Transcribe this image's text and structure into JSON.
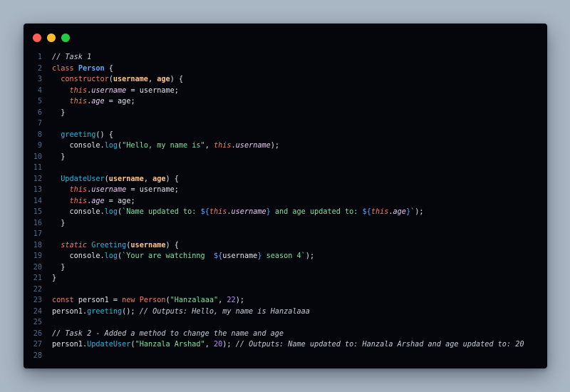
{
  "colors": {
    "background": "#a9b6c3",
    "editor_bg": "#04060b",
    "line_number": "#4e6a8c",
    "default": "#dfe3ea",
    "comment": "#c6ccd6",
    "keyword": "#f07d63",
    "class_name": "#5ba6ff",
    "method": "#27b6d6",
    "param": "#ffc58a",
    "this": "#f07d63",
    "property": "#e9c6ee",
    "string": "#7ee0a0",
    "number": "#bb8ef9",
    "interp": "#5ba6ff",
    "punct": "#dfe3ea",
    "dot_red": "#ff5f57",
    "dot_yellow": "#febc2e",
    "dot_green": "#28c840"
  },
  "window": {
    "controls": [
      "close-dot",
      "minimize-dot",
      "maximize-dot"
    ]
  },
  "lines": [
    {
      "n": "1",
      "tokens": [
        {
          "t": "// Task 1",
          "c": "comment"
        }
      ]
    },
    {
      "n": "2",
      "tokens": [
        {
          "t": "class ",
          "c": "keyword"
        },
        {
          "t": "Person",
          "c": "class_name",
          "b": true
        },
        {
          "t": " {",
          "c": "punct"
        }
      ]
    },
    {
      "n": "3",
      "tokens": [
        {
          "t": "  constructor",
          "c": "keyword"
        },
        {
          "t": "(",
          "c": "punct"
        },
        {
          "t": "username",
          "c": "param",
          "b": true
        },
        {
          "t": ", ",
          "c": "punct"
        },
        {
          "t": "age",
          "c": "param",
          "b": true
        },
        {
          "t": ") {",
          "c": "punct"
        }
      ]
    },
    {
      "n": "4",
      "tokens": [
        {
          "t": "    ",
          "c": "punct"
        },
        {
          "t": "this",
          "c": "this",
          "i": true
        },
        {
          "t": ".",
          "c": "punct"
        },
        {
          "t": "username",
          "c": "property",
          "i": true
        },
        {
          "t": " = ",
          "c": "punct"
        },
        {
          "t": "username",
          "c": "default"
        },
        {
          "t": ";",
          "c": "punct"
        }
      ]
    },
    {
      "n": "5",
      "tokens": [
        {
          "t": "    ",
          "c": "punct"
        },
        {
          "t": "this",
          "c": "this",
          "i": true
        },
        {
          "t": ".",
          "c": "punct"
        },
        {
          "t": "age",
          "c": "property",
          "i": true
        },
        {
          "t": " = ",
          "c": "punct"
        },
        {
          "t": "age",
          "c": "default"
        },
        {
          "t": ";",
          "c": "punct"
        }
      ]
    },
    {
      "n": "6",
      "tokens": [
        {
          "t": "  }",
          "c": "punct"
        }
      ]
    },
    {
      "n": "7",
      "tokens": []
    },
    {
      "n": "8",
      "tokens": [
        {
          "t": "  greeting",
          "c": "method"
        },
        {
          "t": "() {",
          "c": "punct"
        }
      ]
    },
    {
      "n": "9",
      "tokens": [
        {
          "t": "    console",
          "c": "default"
        },
        {
          "t": ".",
          "c": "punct"
        },
        {
          "t": "log",
          "c": "method"
        },
        {
          "t": "(",
          "c": "punct"
        },
        {
          "t": "\"Hello, my name is\"",
          "c": "string"
        },
        {
          "t": ", ",
          "c": "punct"
        },
        {
          "t": "this",
          "c": "this",
          "i": true
        },
        {
          "t": ".",
          "c": "punct"
        },
        {
          "t": "username",
          "c": "property",
          "i": true
        },
        {
          "t": ");",
          "c": "punct"
        }
      ]
    },
    {
      "n": "10",
      "tokens": [
        {
          "t": "  }",
          "c": "punct"
        }
      ]
    },
    {
      "n": "11",
      "tokens": []
    },
    {
      "n": "12",
      "tokens": [
        {
          "t": "  UpdateUser",
          "c": "method"
        },
        {
          "t": "(",
          "c": "punct"
        },
        {
          "t": "username",
          "c": "param",
          "b": true
        },
        {
          "t": ", ",
          "c": "punct"
        },
        {
          "t": "age",
          "c": "param",
          "b": true
        },
        {
          "t": ") {",
          "c": "punct"
        }
      ]
    },
    {
      "n": "13",
      "tokens": [
        {
          "t": "    ",
          "c": "punct"
        },
        {
          "t": "this",
          "c": "this",
          "i": true
        },
        {
          "t": ".",
          "c": "punct"
        },
        {
          "t": "username",
          "c": "property",
          "i": true
        },
        {
          "t": " = ",
          "c": "punct"
        },
        {
          "t": "username",
          "c": "default"
        },
        {
          "t": ";",
          "c": "punct"
        }
      ]
    },
    {
      "n": "14",
      "tokens": [
        {
          "t": "    ",
          "c": "punct"
        },
        {
          "t": "this",
          "c": "this",
          "i": true
        },
        {
          "t": ".",
          "c": "punct"
        },
        {
          "t": "age",
          "c": "property",
          "i": true
        },
        {
          "t": " = ",
          "c": "punct"
        },
        {
          "t": "age",
          "c": "default"
        },
        {
          "t": ";",
          "c": "punct"
        }
      ]
    },
    {
      "n": "15",
      "tokens": [
        {
          "t": "    console",
          "c": "default"
        },
        {
          "t": ".",
          "c": "punct"
        },
        {
          "t": "log",
          "c": "method"
        },
        {
          "t": "(",
          "c": "punct"
        },
        {
          "t": "`Name updated to: ",
          "c": "string"
        },
        {
          "t": "${",
          "c": "interp"
        },
        {
          "t": "this",
          "c": "this",
          "i": true
        },
        {
          "t": ".",
          "c": "punct"
        },
        {
          "t": "username",
          "c": "property",
          "i": true
        },
        {
          "t": "}",
          "c": "interp"
        },
        {
          "t": " and age updated to: ",
          "c": "string"
        },
        {
          "t": "${",
          "c": "interp"
        },
        {
          "t": "this",
          "c": "this",
          "i": true
        },
        {
          "t": ".",
          "c": "punct"
        },
        {
          "t": "age",
          "c": "property",
          "i": true
        },
        {
          "t": "}",
          "c": "interp"
        },
        {
          "t": "`",
          "c": "string"
        },
        {
          "t": ");",
          "c": "punct"
        }
      ]
    },
    {
      "n": "16",
      "tokens": [
        {
          "t": "  }",
          "c": "punct"
        }
      ]
    },
    {
      "n": "17",
      "tokens": []
    },
    {
      "n": "18",
      "tokens": [
        {
          "t": "  static ",
          "c": "keyword",
          "i": true
        },
        {
          "t": "Greeting",
          "c": "method"
        },
        {
          "t": "(",
          "c": "punct"
        },
        {
          "t": "username",
          "c": "param",
          "b": true
        },
        {
          "t": ") {",
          "c": "punct"
        }
      ]
    },
    {
      "n": "19",
      "tokens": [
        {
          "t": "    console",
          "c": "default"
        },
        {
          "t": ".",
          "c": "punct"
        },
        {
          "t": "log",
          "c": "method"
        },
        {
          "t": "(",
          "c": "punct"
        },
        {
          "t": "`Your are watchinng  ",
          "c": "string"
        },
        {
          "t": "${",
          "c": "interp"
        },
        {
          "t": "username",
          "c": "default"
        },
        {
          "t": "}",
          "c": "interp"
        },
        {
          "t": " season 4`",
          "c": "string"
        },
        {
          "t": ");",
          "c": "punct"
        }
      ]
    },
    {
      "n": "20",
      "tokens": [
        {
          "t": "  }",
          "c": "punct"
        }
      ]
    },
    {
      "n": "21",
      "tokens": [
        {
          "t": "}",
          "c": "punct"
        }
      ]
    },
    {
      "n": "22",
      "tokens": []
    },
    {
      "n": "23",
      "tokens": [
        {
          "t": "const ",
          "c": "keyword"
        },
        {
          "t": "person1",
          "c": "default"
        },
        {
          "t": " = ",
          "c": "punct"
        },
        {
          "t": "new ",
          "c": "keyword"
        },
        {
          "t": "Person",
          "c": "keyword"
        },
        {
          "t": "(",
          "c": "punct"
        },
        {
          "t": "\"Hanzalaaa\"",
          "c": "string"
        },
        {
          "t": ", ",
          "c": "punct"
        },
        {
          "t": "22",
          "c": "number"
        },
        {
          "t": ");",
          "c": "punct"
        }
      ]
    },
    {
      "n": "24",
      "tokens": [
        {
          "t": "person1",
          "c": "default"
        },
        {
          "t": ".",
          "c": "punct"
        },
        {
          "t": "greeting",
          "c": "method"
        },
        {
          "t": "(); ",
          "c": "punct"
        },
        {
          "t": "// Outputs: Hello, my name is Hanzalaaa",
          "c": "comment"
        }
      ]
    },
    {
      "n": "25",
      "tokens": []
    },
    {
      "n": "26",
      "tokens": [
        {
          "t": "// Task 2 - Added a method to change the name and age",
          "c": "comment"
        }
      ]
    },
    {
      "n": "27",
      "tokens": [
        {
          "t": "person1",
          "c": "default"
        },
        {
          "t": ".",
          "c": "punct"
        },
        {
          "t": "UpdateUser",
          "c": "method"
        },
        {
          "t": "(",
          "c": "punct"
        },
        {
          "t": "\"Hanzala Arshad\"",
          "c": "string"
        },
        {
          "t": ", ",
          "c": "punct"
        },
        {
          "t": "20",
          "c": "number"
        },
        {
          "t": "); ",
          "c": "punct"
        },
        {
          "t": "// Outputs: Name updated to: Hanzala Arshad and age updated to: 20",
          "c": "comment"
        }
      ]
    },
    {
      "n": "28",
      "tokens": []
    }
  ]
}
